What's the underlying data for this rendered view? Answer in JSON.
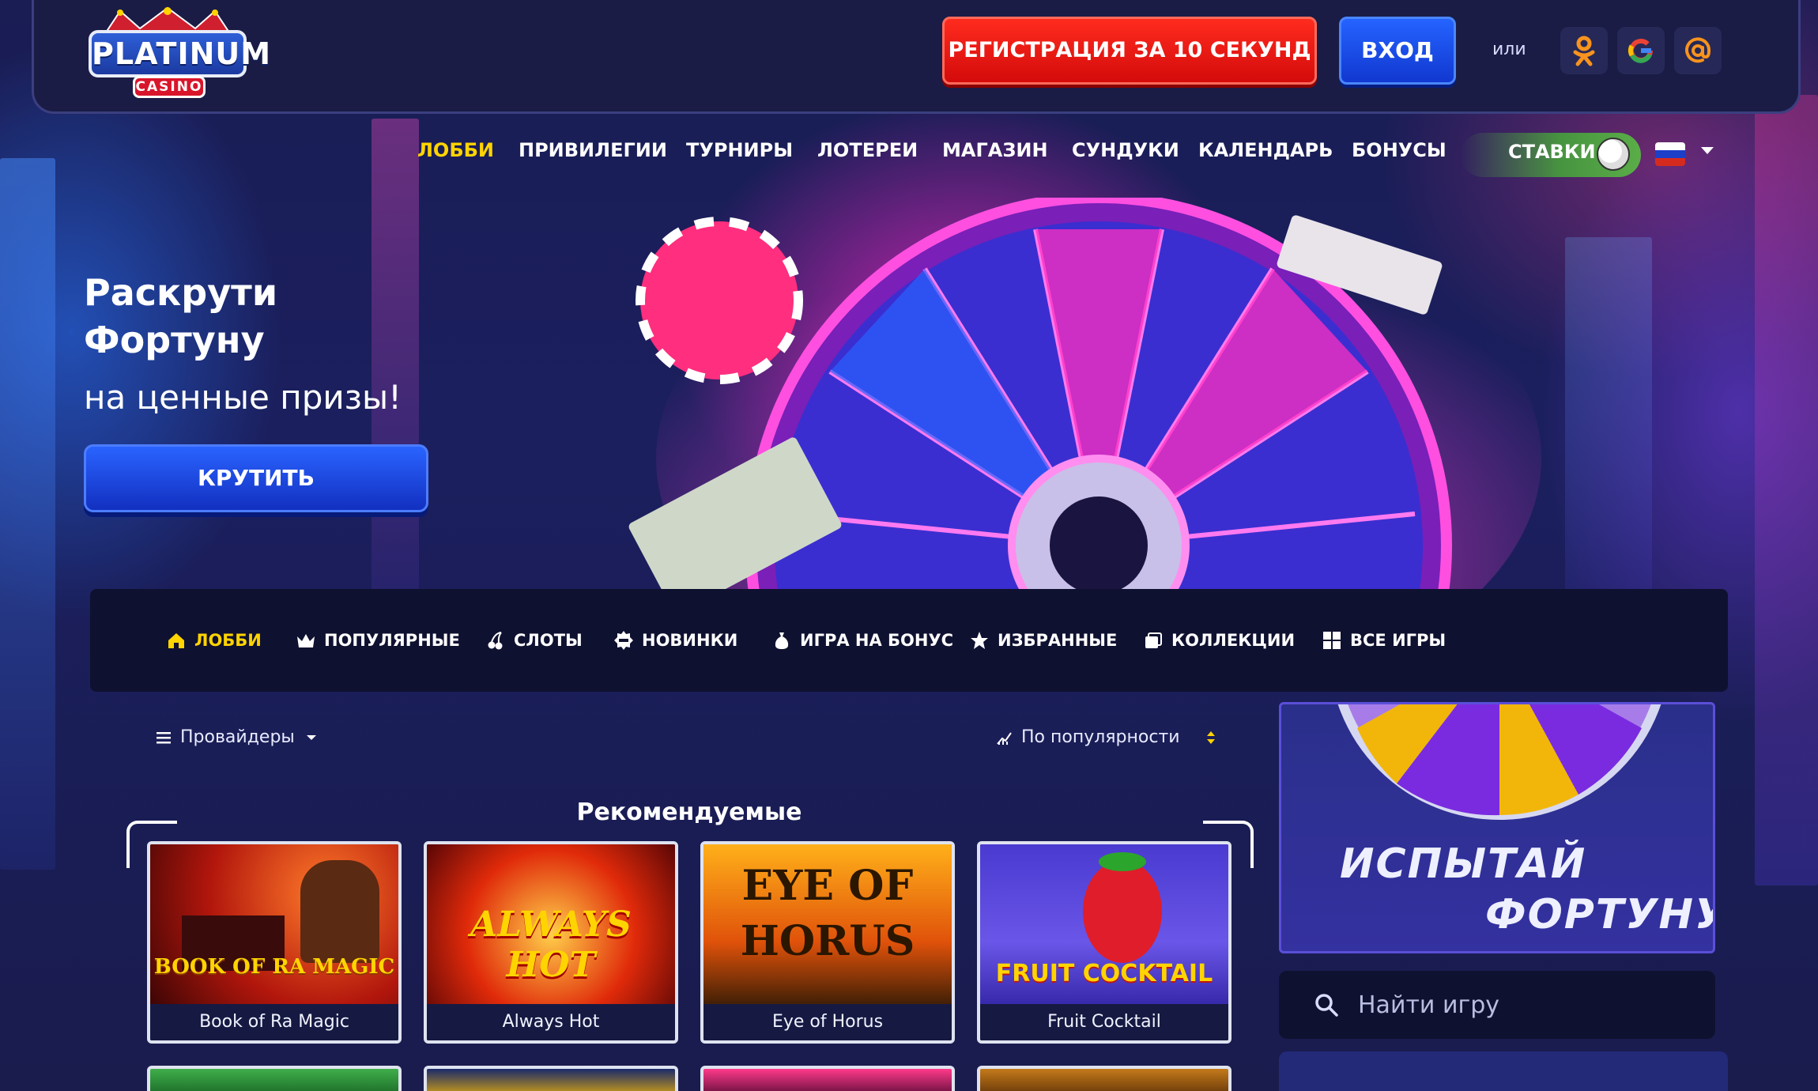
{
  "header": {
    "logo_text": "PLATINUM",
    "logo_sub": "CASINO",
    "register_label": "РЕГИСТРАЦИЯ ЗА 10 СЕКУНД",
    "login_label": "ВХОД",
    "or_label": "или"
  },
  "topnav": {
    "items": [
      "ЛОББИ",
      "ПРИВИЛЕГИИ",
      "ТУРНИРЫ",
      "ЛОТЕРЕИ",
      "МАГАЗИН",
      "СУНДУКИ",
      "КАЛЕНДАРЬ",
      "БОНУСЫ"
    ],
    "bets_label": "СТАВКИ"
  },
  "hero": {
    "title_line1": "Раскрути",
    "title_line2": "Фортуну",
    "subtitle": "на ценные призы!",
    "button_label": "КРУТИТЬ"
  },
  "categories": [
    "ЛОББИ",
    "ПОПУЛЯРНЫЕ",
    "СЛОТЫ",
    "НОВИНКИ",
    "ИГРА НА БОНУС",
    "ИЗБРАННЫЕ",
    "КОЛЛЕКЦИИ",
    "ВСЕ ИГРЫ"
  ],
  "filters": {
    "providers_label": "Провайдеры",
    "sort_label": "По популярности"
  },
  "recommended": {
    "title": "Рекомендуемые",
    "games": [
      {
        "name": "Book of Ra Magic",
        "art": "BOOK OF RA MAGIC"
      },
      {
        "name": "Always Hot",
        "art": "ALWAYS HOT"
      },
      {
        "name": "Eye of Horus",
        "art_line1": "EYE OF",
        "art_line2": "HORUS"
      },
      {
        "name": "Fruit Cocktail",
        "art": "FRUIT COCKTAIL"
      }
    ]
  },
  "promo": {
    "line1": "ИСПЫТАЙ",
    "line2": "ФОРТУНУ"
  },
  "search": {
    "placeholder": "Найти игру"
  },
  "colors": {
    "accent_yellow": "#ffd400",
    "register_red": "#e01212",
    "login_blue": "#1f4fe8"
  }
}
